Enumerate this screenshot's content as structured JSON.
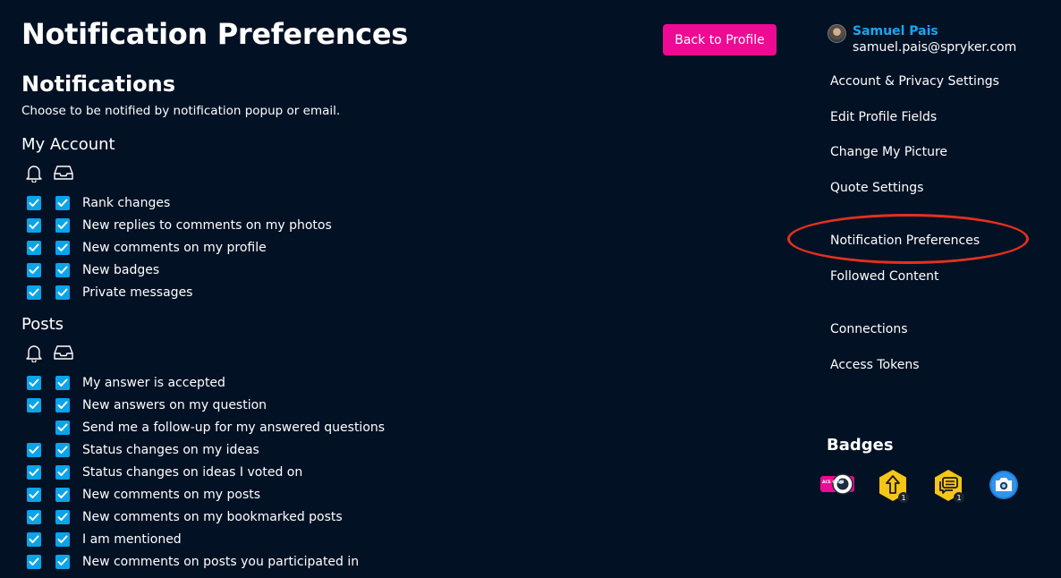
{
  "header": {
    "title": "Notification Preferences",
    "back_button": "Back to Profile"
  },
  "notifications": {
    "title": "Notifications",
    "description": "Choose to be notified by notification popup or email."
  },
  "groups": {
    "my_account": {
      "title": "My Account",
      "items": [
        {
          "label": "Rank changes",
          "popup": true,
          "email": true
        },
        {
          "label": "New replies to comments on my photos",
          "popup": true,
          "email": true
        },
        {
          "label": "New comments on my profile",
          "popup": true,
          "email": true
        },
        {
          "label": "New badges",
          "popup": true,
          "email": true
        },
        {
          "label": "Private messages",
          "popup": true,
          "email": true
        }
      ]
    },
    "posts": {
      "title": "Posts",
      "items": [
        {
          "label": "My answer is accepted",
          "popup": true,
          "email": true
        },
        {
          "label": "New answers on my question",
          "popup": true,
          "email": true
        },
        {
          "label": "Send me a follow-up for my answered questions",
          "popup": null,
          "email": true
        },
        {
          "label": "Status changes on my ideas",
          "popup": true,
          "email": true
        },
        {
          "label": "Status changes on ideas I voted on",
          "popup": true,
          "email": true
        },
        {
          "label": "New comments on my posts",
          "popup": true,
          "email": true
        },
        {
          "label": "New comments on my bookmarked posts",
          "popup": true,
          "email": true
        },
        {
          "label": "I am mentioned",
          "popup": true,
          "email": true
        },
        {
          "label": "New comments on posts you participated in",
          "popup": true,
          "email": true
        }
      ]
    }
  },
  "sidebar": {
    "user": {
      "name": "Samuel Pais",
      "email": "samuel.pais@spryker.com"
    },
    "links": [
      {
        "label": "Account & Privacy Settings"
      },
      {
        "label": "Edit Profile Fields"
      },
      {
        "label": "Change My Picture"
      },
      {
        "label": "Quote Settings"
      },
      {
        "label": "Notification Preferences",
        "active": true
      },
      {
        "label": "Followed Content"
      },
      {
        "label": "Connections"
      },
      {
        "label": "Access Tokens"
      }
    ]
  },
  "badges": {
    "title": "Badges",
    "items": [
      {
        "icon": "astronaut-badge-icon",
        "text": "ACE CLUB",
        "count": ""
      },
      {
        "icon": "up-arrow-hexagon-badge-icon",
        "count": "1"
      },
      {
        "icon": "chat-bubbles-hexagon-badge-icon",
        "count": "1"
      },
      {
        "icon": "camera-badge-icon",
        "count": ""
      }
    ]
  },
  "colors": {
    "background": "#031124",
    "accent_pink": "#ec0b92",
    "checkbox_blue": "#0aa4ea",
    "username_blue": "#19a6f2",
    "highlight_red": "#e5301e",
    "badge_yellow": "#f5c518"
  }
}
